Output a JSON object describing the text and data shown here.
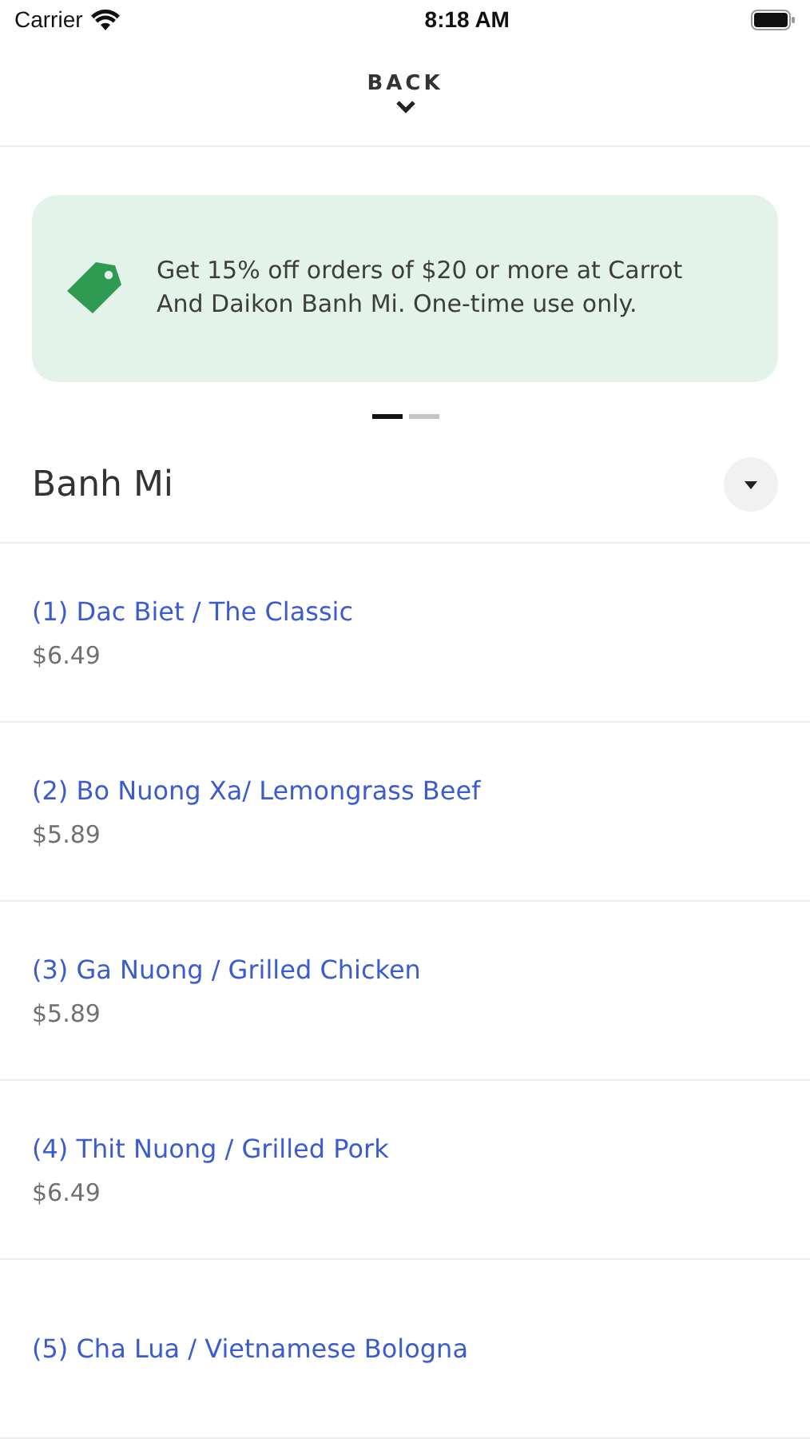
{
  "status_bar": {
    "carrier": "Carrier",
    "time": "8:18 AM"
  },
  "header": {
    "back_label": "BACK"
  },
  "promos": [
    {
      "text": "Get 15% off orders of $20 or more at Carrot And Daikon Banh Mi. One-time use only."
    }
  ],
  "pager": [
    {
      "selected": true
    },
    {
      "selected": false
    }
  ],
  "section": {
    "title": "Banh Mi",
    "expanded": true
  },
  "items": [
    {
      "name": "(1) Dac Biet / The Classic",
      "price": "$6.49"
    },
    {
      "name": "(2) Bo Nuong Xa/ Lemongrass Beef",
      "price": "$5.89"
    },
    {
      "name": "(3) Ga Nuong / Grilled Chicken",
      "price": "$5.89"
    },
    {
      "name": "(4) Thit Nuong / Grilled Pork",
      "price": "$6.49"
    },
    {
      "name": "(5) Cha Lua / Vietnamese Bologna"
    }
  ]
}
